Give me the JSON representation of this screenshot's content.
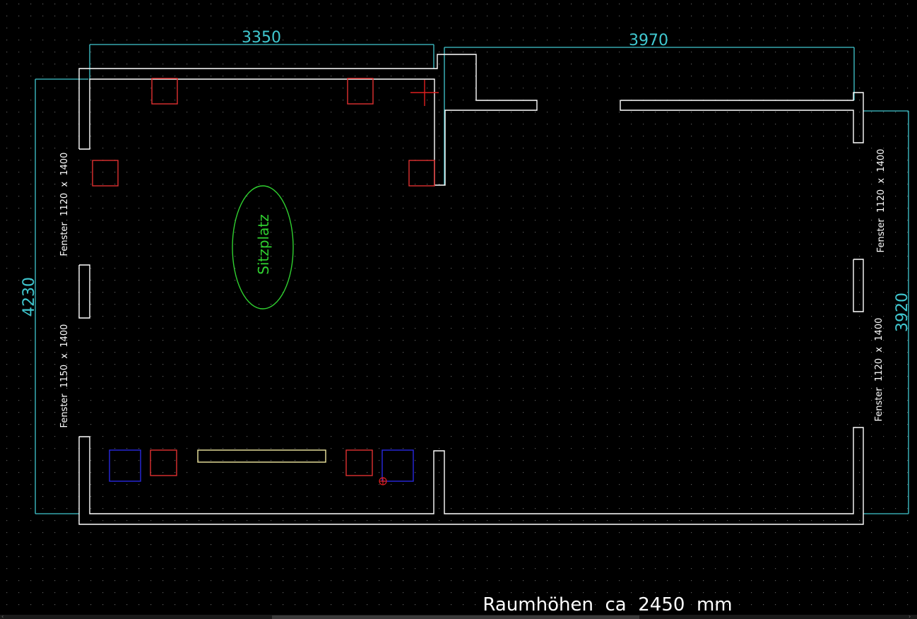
{
  "drawing": {
    "dimensions": {
      "top_left_width": "3350",
      "top_right_width": "3970",
      "left_height": "4230",
      "right_height": "3920"
    },
    "labels": {
      "window_left_top": "Fenster  1120  x  1400",
      "window_left_bottom": "Fenster  1150  x  1400",
      "window_right_top": "Fenster  1120  x  1400",
      "window_right_bottom": "Fenster  1120  x  1400",
      "seating": "Sitzplatz",
      "room_height_note": "Raumhöhen  ca  2450  mm"
    },
    "colors": {
      "background": "#000000",
      "grid_dot": "#5a5a5a",
      "wall": "#ffffff",
      "dimension": "#40c8d0",
      "object_red": "#e03030",
      "object_blue": "#2828e0",
      "object_yellow": "#f0e8a0",
      "seating_green": "#30d030",
      "cursor_red": "#e02020"
    }
  },
  "ui": {
    "scroll_left_icon": "left-arrow",
    "scroll_right_icon": "right-arrow"
  }
}
